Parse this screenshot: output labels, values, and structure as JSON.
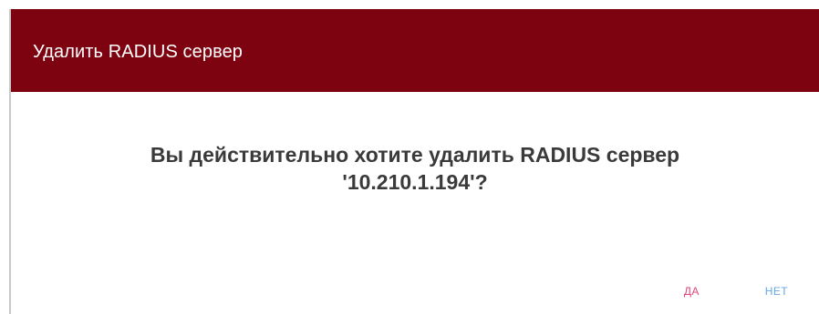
{
  "dialog": {
    "title": "Удалить RADIUS сервер",
    "message_line1": "Вы действительно хотите удалить RADIUS сервер",
    "message_line2": "'10.210.1.194'?",
    "confirm_label": "ДА",
    "cancel_label": "НЕТ"
  },
  "colors": {
    "header_bg": "#7d0310",
    "confirm": "#e0457a",
    "cancel": "#66a6ea"
  }
}
